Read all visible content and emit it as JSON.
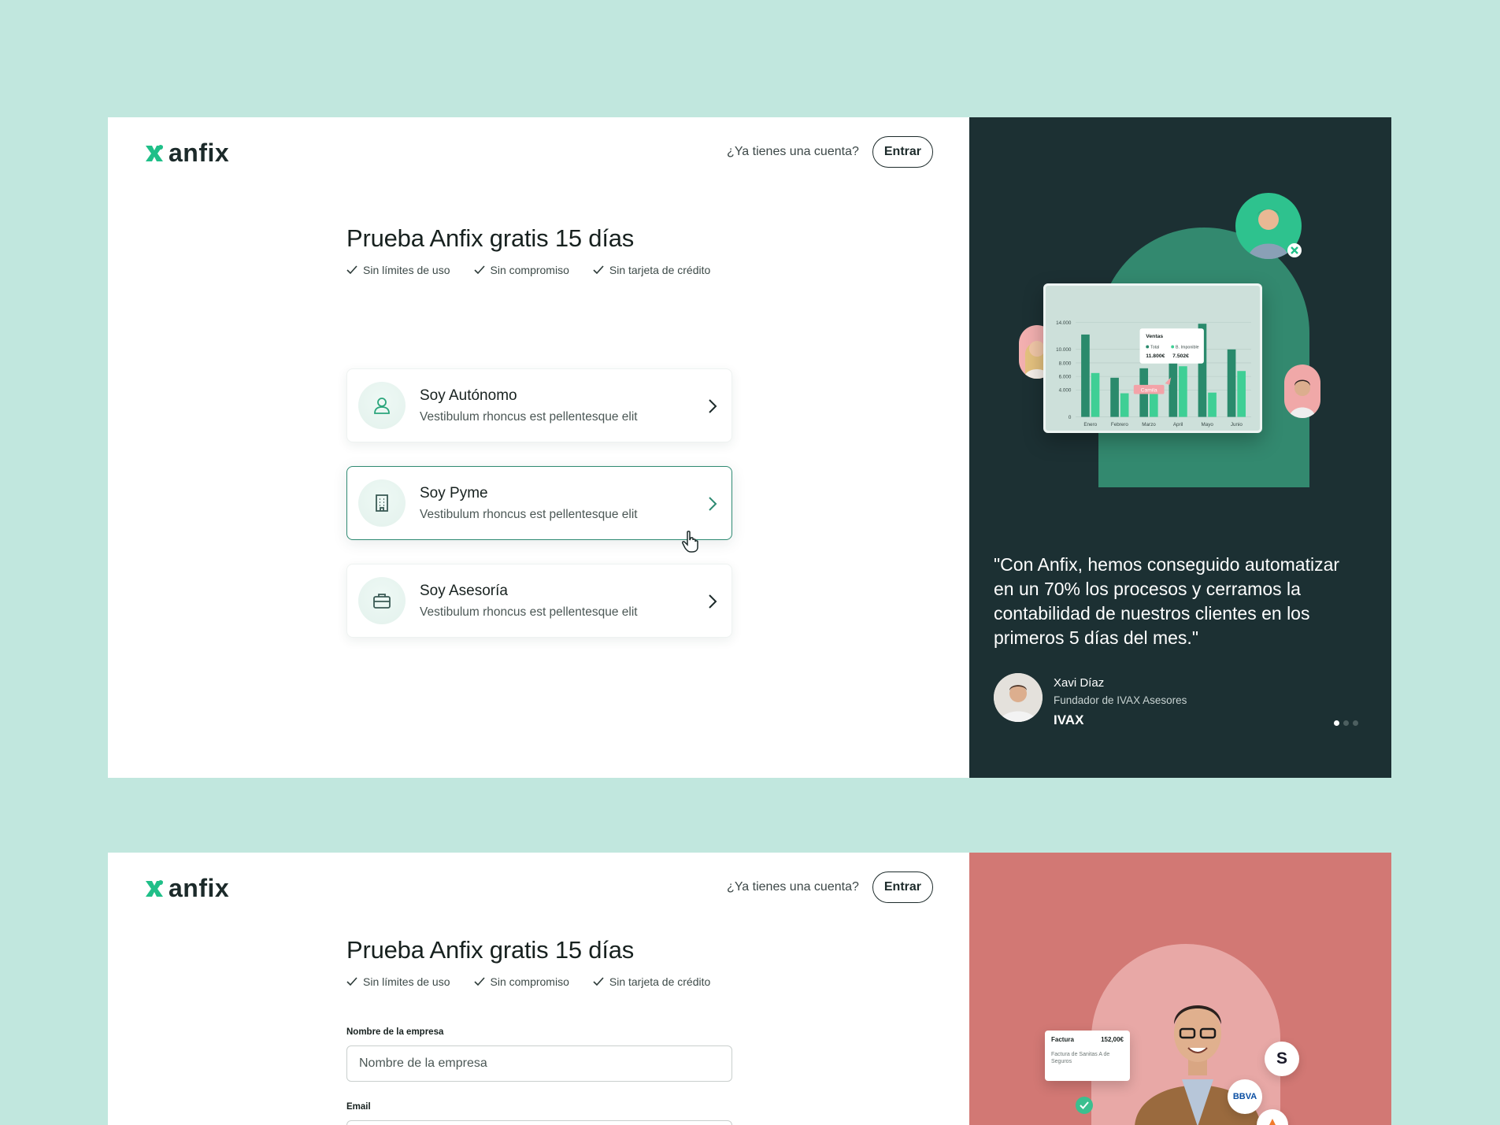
{
  "brand": {
    "name": "anfix",
    "accent": "#1fbf88",
    "dark_panel": "#1c3033",
    "pink_panel": "#d27874",
    "background": "#c1e7de"
  },
  "header": {
    "question": "¿Ya tienes una cuenta?",
    "login_label": "Entrar"
  },
  "hero": {
    "title": "Prueba Anfix gratis 15 días",
    "benefits": [
      "Sin límites de uso",
      "Sin compromiso",
      "Sin tarjeta de crédito"
    ]
  },
  "options": [
    {
      "title": "Soy Autónomo",
      "description": "Vestibulum rhoncus est pellentesque elit",
      "icon": "user-icon",
      "selected": false
    },
    {
      "title": "Soy Pyme",
      "description": "Vestibulum rhoncus est pellentesque elit",
      "icon": "building-icon",
      "selected": true
    },
    {
      "title": "Soy Asesoría",
      "description": "Vestibulum rhoncus est pellentesque elit",
      "icon": "briefcase-icon",
      "selected": false
    }
  ],
  "testimonial": {
    "quote": "\"Con Anfix, hemos conseguido automatizar en un 70% los procesos y cerramos la contabilidad de nuestros clientes en los primeros 5 días del mes.\"",
    "author_name": "Xavi Díaz",
    "author_role": "Fundador de IVAX Asesores",
    "company": "IVAX",
    "slides": 3,
    "active_slide": 1
  },
  "mini_chart": {
    "tooltip_title": "Ventas",
    "legend": [
      "Total",
      "B. Imponible"
    ],
    "tooltip_values": [
      "11.800€",
      "7.502€"
    ],
    "tag": "Camila",
    "y_ticks": [
      "14.000",
      "10.000",
      "8.000",
      "6.000",
      "4.000",
      "0"
    ],
    "categories": [
      "Enero",
      "Febrero",
      "Marzo",
      "April",
      "Mayo",
      "Junio"
    ],
    "total": [
      12200,
      5800,
      7200,
      11800,
      13800,
      10000
    ],
    "imponible": [
      6500,
      3500,
      4200,
      7502,
      3600,
      6800
    ]
  },
  "form": {
    "company_label": "Nombre de la empresa",
    "company_placeholder": "Nombre de la empresa",
    "email_label": "Email"
  },
  "promo": {
    "invoice_title": "Factura",
    "invoice_amount": "152,00€",
    "invoice_desc": "Factura de Sanitas A de Seguros",
    "bank_1": "S",
    "bank_2": "BBVA"
  }
}
